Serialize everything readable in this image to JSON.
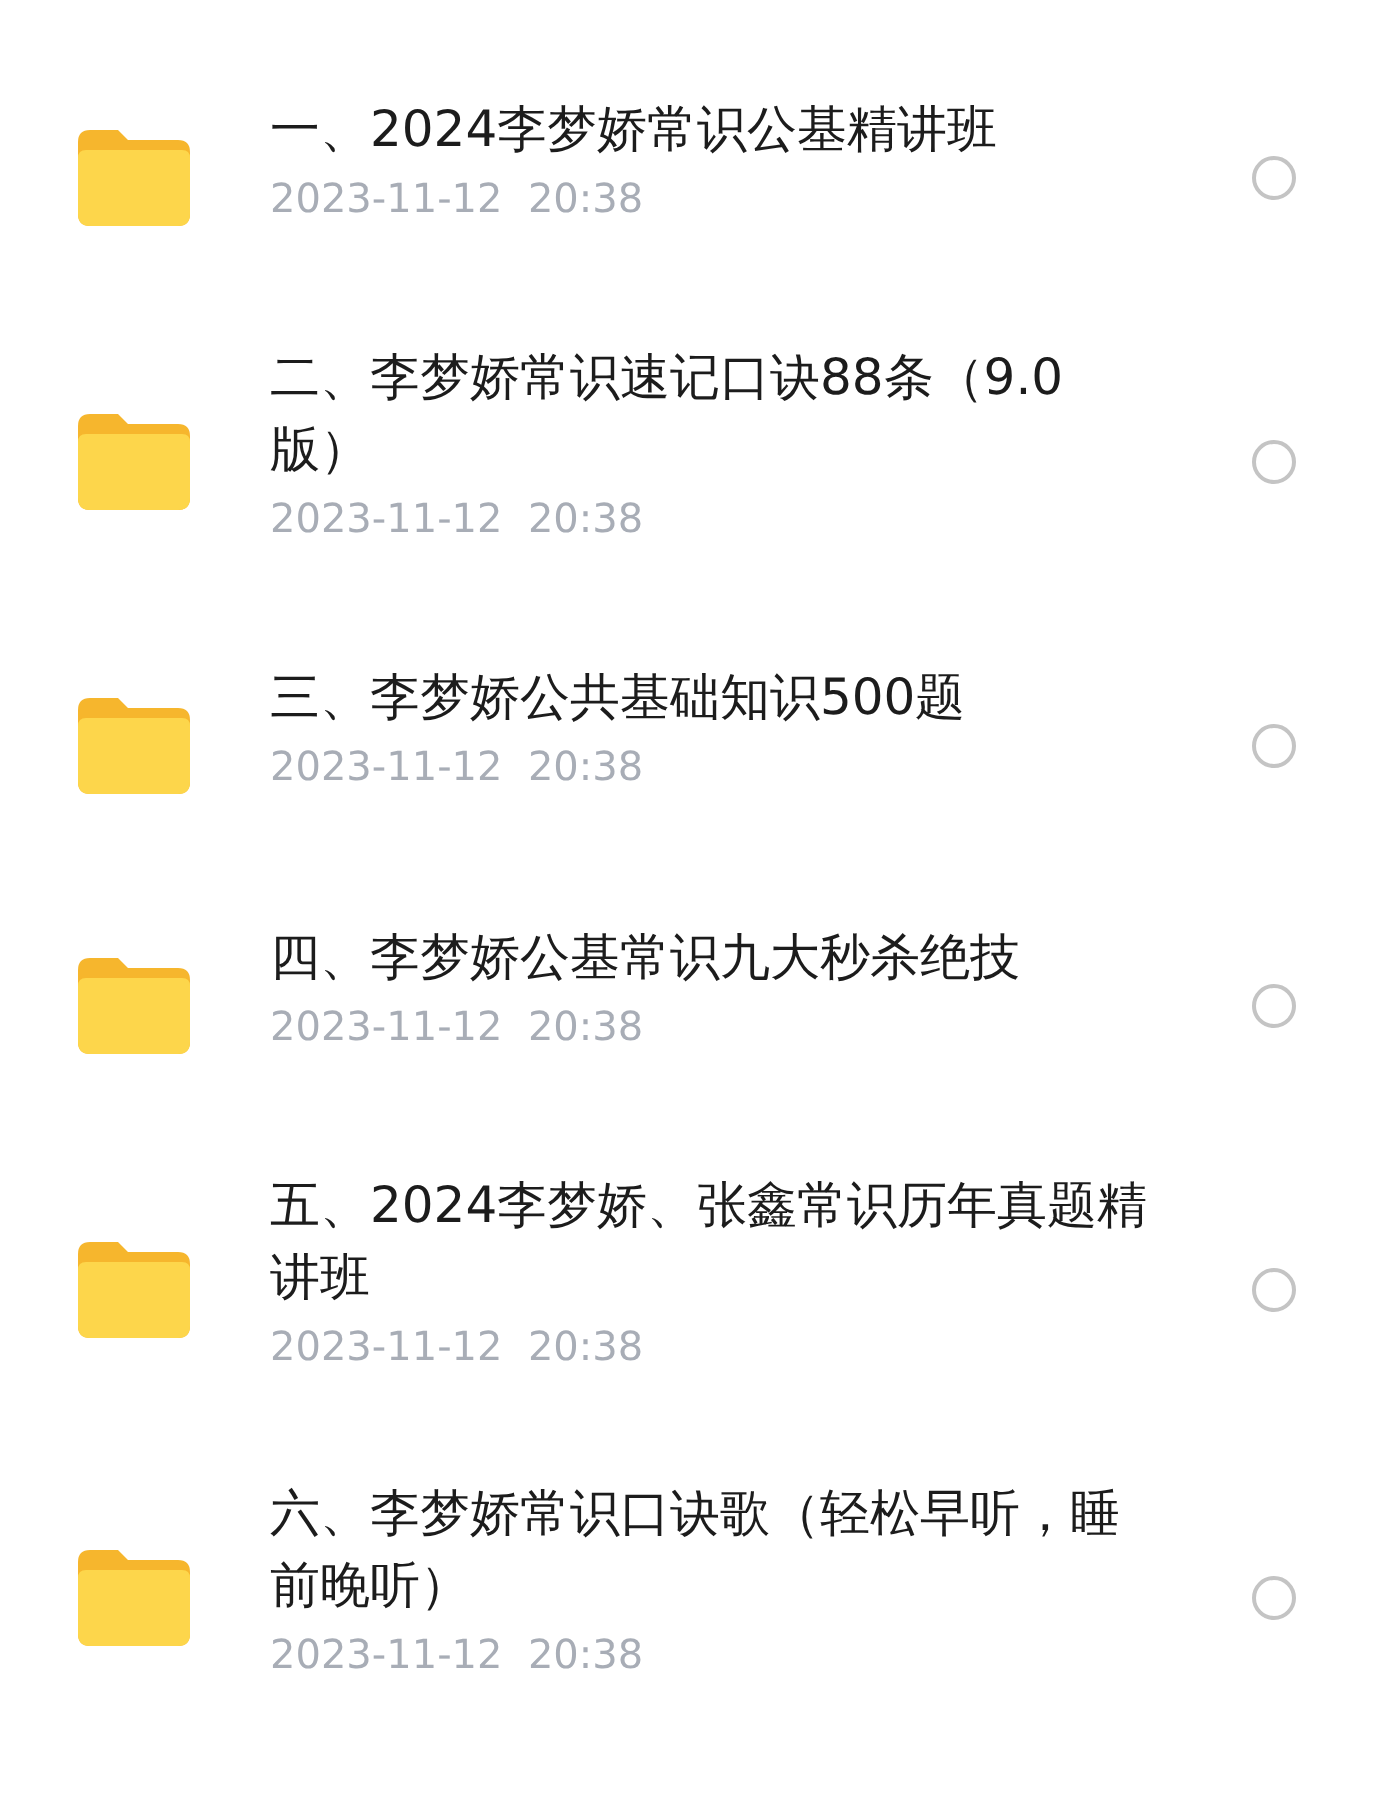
{
  "files": [
    {
      "title": "一、2024李梦娇常识公基精讲班",
      "date": "2023-11-12  20:38",
      "selected": false
    },
    {
      "title": "二、李梦娇常识速记口诀88条（9.0版）",
      "date": "2023-11-12  20:38",
      "selected": false
    },
    {
      "title": "三、李梦娇公共基础知识500题",
      "date": "2023-11-12  20:38",
      "selected": false
    },
    {
      "title": "四、李梦娇公基常识九大秒杀绝技",
      "date": "2023-11-12  20:38",
      "selected": false
    },
    {
      "title": "五、2024李梦娇、张鑫常识历年真题精讲班",
      "date": "2023-11-12  20:38",
      "selected": false
    },
    {
      "title": "六、李梦娇常识口诀歌（轻松早听，睡前晚听）",
      "date": "2023-11-12  20:38",
      "selected": false
    }
  ]
}
